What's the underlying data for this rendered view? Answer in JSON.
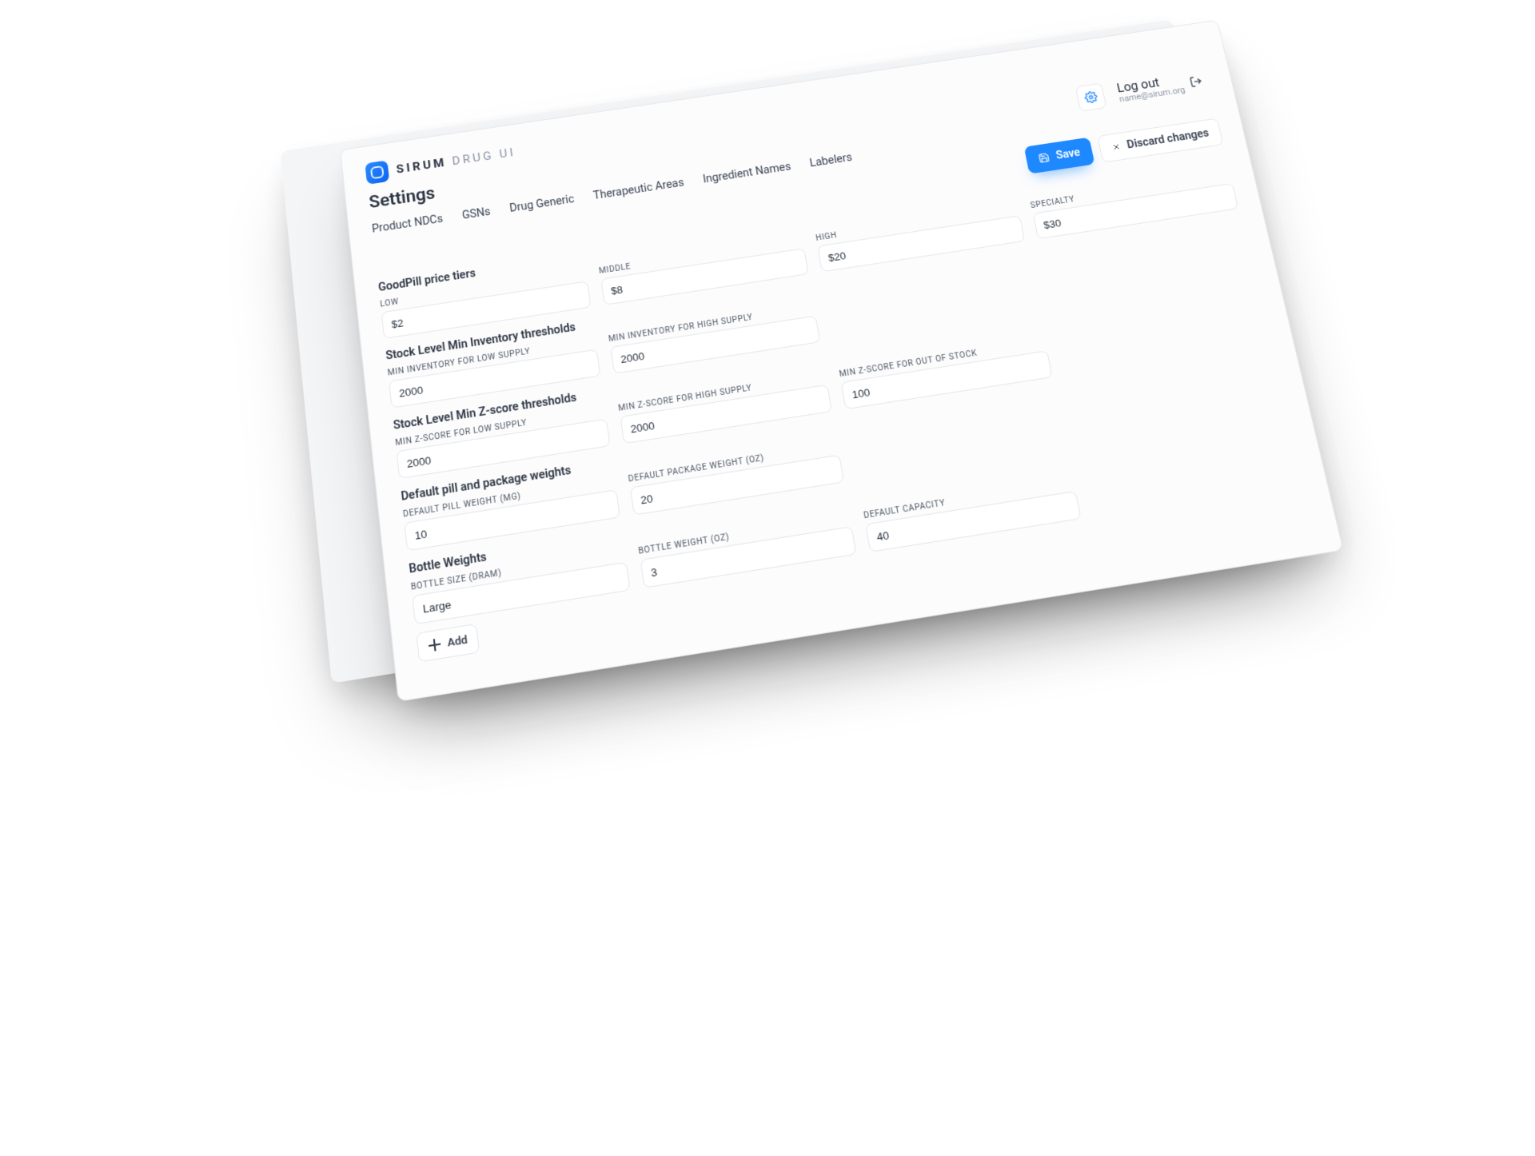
{
  "brand": {
    "name": "SIRUM",
    "suffix": "DRUG UI"
  },
  "page": {
    "title": "Settings"
  },
  "tabs": {
    "product_ndcs": "Product NDCs",
    "gsns": "GSNs",
    "drug_generic": "Drug Generic",
    "therapeutic_areas": "Therapeutic Areas",
    "ingredient_names": "Ingredient Names",
    "labelers": "Labelers"
  },
  "auth": {
    "logout_label": "Log out",
    "email": "name@sirum.org"
  },
  "actions": {
    "save": "Save",
    "discard": "Discard changes"
  },
  "goodpill": {
    "title": "GoodPill price tiers",
    "low": {
      "label": "LOW",
      "value": "$2"
    },
    "middle": {
      "label": "MIDDLE",
      "value": "$8"
    },
    "high": {
      "label": "HIGH",
      "value": "$20"
    },
    "specialty": {
      "label": "SPECIALTY",
      "value": "$30"
    }
  },
  "stock_inventory": {
    "title": "Stock Level Min Inventory thresholds",
    "low": {
      "label": "MIN INVENTORY FOR LOW SUPPLY",
      "value": "2000"
    },
    "high": {
      "label": "MIN INVENTORY FOR HIGH SUPPLY",
      "value": "2000"
    }
  },
  "stock_zscore": {
    "title": "Stock Level Min Z-score thresholds",
    "low": {
      "label": "MIN Z-SCORE FOR LOW SUPPLY",
      "value": "2000"
    },
    "high": {
      "label": "MIN Z-SCORE FOR HIGH SUPPLY",
      "value": "2000"
    },
    "oos": {
      "label": "MIN Z-SCORE FOR OUT OF STOCK",
      "value": "100"
    }
  },
  "defaults": {
    "title": "Default pill and package weights",
    "pill": {
      "label": "DEFAULT PILL WEIGHT (MG)",
      "value": "10"
    },
    "package": {
      "label": "DEFAULT PACKAGE WEIGHT (OZ)",
      "value": "20"
    }
  },
  "bottle": {
    "title": "Bottle Weights",
    "size": {
      "label": "BOTTLE SIZE (DRAM)",
      "value": "Large"
    },
    "weight": {
      "label": "BOTTLE WEIGHT (OZ)",
      "value": "3"
    },
    "capacity": {
      "label": "DEFAULT CAPACITY",
      "value": "40"
    },
    "add_label": "Add"
  }
}
